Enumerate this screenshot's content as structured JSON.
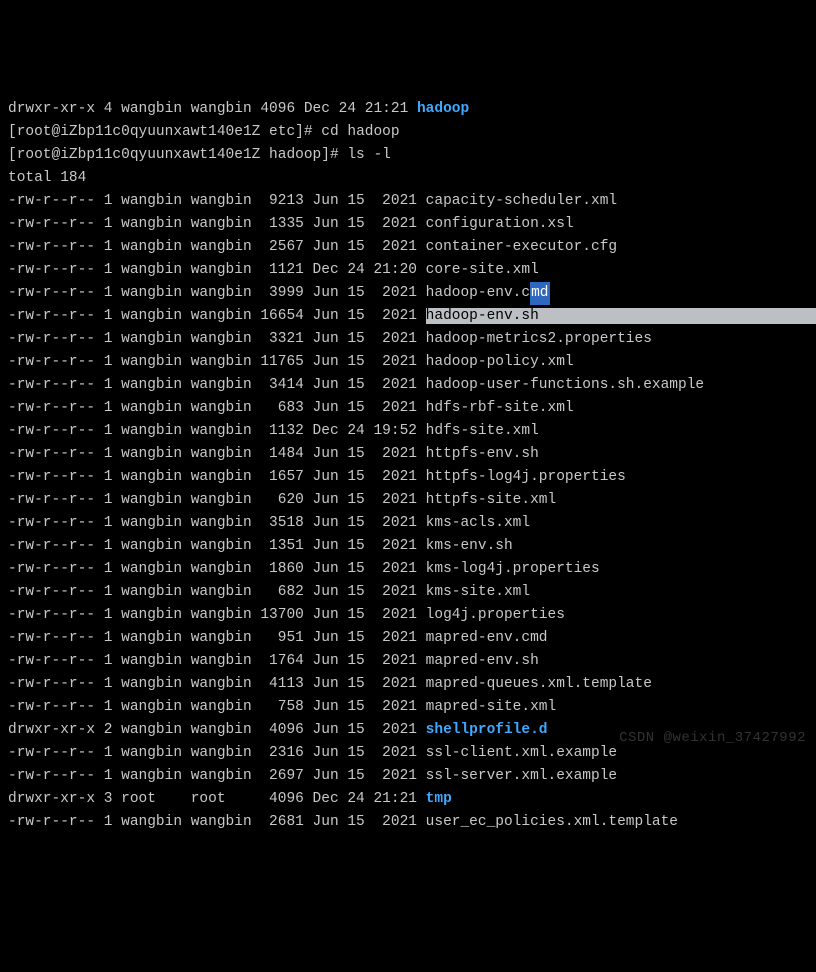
{
  "top_line": {
    "perm": "drwxr-xr-x",
    "links": "4",
    "owner": "wangbin",
    "group": "wangbin",
    "size": "4096",
    "month": "Dec",
    "day": "24",
    "time": "21:21",
    "name": "hadoop"
  },
  "prompts": {
    "line_a_pre": "[root@iZbp11c0qyuunxawt140e1Z etc]# ",
    "line_a_cmd": "cd hadoop",
    "line_b_pre": "[root@iZbp11c0qyuunxawt140e1Z hadoop]# ",
    "line_b_cmd": "ls -l"
  },
  "total_line": "total 184",
  "files": [
    {
      "perm": "-rw-r--r--",
      "links": "1",
      "owner": "wangbin",
      "group": "wangbin",
      "size": "9213",
      "month": "Jun",
      "day": "15",
      "time": "2021",
      "name": "capacity-scheduler.xml",
      "type": "file"
    },
    {
      "perm": "-rw-r--r--",
      "links": "1",
      "owner": "wangbin",
      "group": "wangbin",
      "size": "1335",
      "month": "Jun",
      "day": "15",
      "time": "2021",
      "name": "configuration.xsl",
      "type": "file"
    },
    {
      "perm": "-rw-r--r--",
      "links": "1",
      "owner": "wangbin",
      "group": "wangbin",
      "size": "2567",
      "month": "Jun",
      "day": "15",
      "time": "2021",
      "name": "container-executor.cfg",
      "type": "file"
    },
    {
      "perm": "-rw-r--r--",
      "links": "1",
      "owner": "wangbin",
      "group": "wangbin",
      "size": "1121",
      "month": "Dec",
      "day": "24",
      "time": "21:20",
      "name": "core-site.xml",
      "type": "file"
    },
    {
      "perm": "-rw-r--r--",
      "links": "1",
      "owner": "wangbin",
      "group": "wangbin",
      "size": "3999",
      "month": "Jun",
      "day": "15",
      "time": "2021",
      "name": "hadoop-env.cmd",
      "type": "file",
      "cursor_in_name": true,
      "pre": "hadoop-env.c",
      "cur": "md"
    },
    {
      "perm": "-rw-r--r--",
      "links": "1",
      "owner": "wangbin",
      "group": "wangbin",
      "size": "16654",
      "month": "Jun",
      "day": "15",
      "time": "2021",
      "name": "hadoop-env.sh",
      "type": "file",
      "selected": true
    },
    {
      "perm": "-rw-r--r--",
      "links": "1",
      "owner": "wangbin",
      "group": "wangbin",
      "size": "3321",
      "month": "Jun",
      "day": "15",
      "time": "2021",
      "name": "hadoop-metrics2.properties",
      "type": "file"
    },
    {
      "perm": "-rw-r--r--",
      "links": "1",
      "owner": "wangbin",
      "group": "wangbin",
      "size": "11765",
      "month": "Jun",
      "day": "15",
      "time": "2021",
      "name": "hadoop-policy.xml",
      "type": "file"
    },
    {
      "perm": "-rw-r--r--",
      "links": "1",
      "owner": "wangbin",
      "group": "wangbin",
      "size": "3414",
      "month": "Jun",
      "day": "15",
      "time": "2021",
      "name": "hadoop-user-functions.sh.example",
      "type": "file"
    },
    {
      "perm": "-rw-r--r--",
      "links": "1",
      "owner": "wangbin",
      "group": "wangbin",
      "size": "683",
      "month": "Jun",
      "day": "15",
      "time": "2021",
      "name": "hdfs-rbf-site.xml",
      "type": "file"
    },
    {
      "perm": "-rw-r--r--",
      "links": "1",
      "owner": "wangbin",
      "group": "wangbin",
      "size": "1132",
      "month": "Dec",
      "day": "24",
      "time": "19:52",
      "name": "hdfs-site.xml",
      "type": "file"
    },
    {
      "perm": "-rw-r--r--",
      "links": "1",
      "owner": "wangbin",
      "group": "wangbin",
      "size": "1484",
      "month": "Jun",
      "day": "15",
      "time": "2021",
      "name": "httpfs-env.sh",
      "type": "file"
    },
    {
      "perm": "-rw-r--r--",
      "links": "1",
      "owner": "wangbin",
      "group": "wangbin",
      "size": "1657",
      "month": "Jun",
      "day": "15",
      "time": "2021",
      "name": "httpfs-log4j.properties",
      "type": "file"
    },
    {
      "perm": "-rw-r--r--",
      "links": "1",
      "owner": "wangbin",
      "group": "wangbin",
      "size": "620",
      "month": "Jun",
      "day": "15",
      "time": "2021",
      "name": "httpfs-site.xml",
      "type": "file"
    },
    {
      "perm": "-rw-r--r--",
      "links": "1",
      "owner": "wangbin",
      "group": "wangbin",
      "size": "3518",
      "month": "Jun",
      "day": "15",
      "time": "2021",
      "name": "kms-acls.xml",
      "type": "file"
    },
    {
      "perm": "-rw-r--r--",
      "links": "1",
      "owner": "wangbin",
      "group": "wangbin",
      "size": "1351",
      "month": "Jun",
      "day": "15",
      "time": "2021",
      "name": "kms-env.sh",
      "type": "file"
    },
    {
      "perm": "-rw-r--r--",
      "links": "1",
      "owner": "wangbin",
      "group": "wangbin",
      "size": "1860",
      "month": "Jun",
      "day": "15",
      "time": "2021",
      "name": "kms-log4j.properties",
      "type": "file"
    },
    {
      "perm": "-rw-r--r--",
      "links": "1",
      "owner": "wangbin",
      "group": "wangbin",
      "size": "682",
      "month": "Jun",
      "day": "15",
      "time": "2021",
      "name": "kms-site.xml",
      "type": "file"
    },
    {
      "perm": "-rw-r--r--",
      "links": "1",
      "owner": "wangbin",
      "group": "wangbin",
      "size": "13700",
      "month": "Jun",
      "day": "15",
      "time": "2021",
      "name": "log4j.properties",
      "type": "file"
    },
    {
      "perm": "-rw-r--r--",
      "links": "1",
      "owner": "wangbin",
      "group": "wangbin",
      "size": "951",
      "month": "Jun",
      "day": "15",
      "time": "2021",
      "name": "mapred-env.cmd",
      "type": "file"
    },
    {
      "perm": "-rw-r--r--",
      "links": "1",
      "owner": "wangbin",
      "group": "wangbin",
      "size": "1764",
      "month": "Jun",
      "day": "15",
      "time": "2021",
      "name": "mapred-env.sh",
      "type": "file"
    },
    {
      "perm": "-rw-r--r--",
      "links": "1",
      "owner": "wangbin",
      "group": "wangbin",
      "size": "4113",
      "month": "Jun",
      "day": "15",
      "time": "2021",
      "name": "mapred-queues.xml.template",
      "type": "file"
    },
    {
      "perm": "-rw-r--r--",
      "links": "1",
      "owner": "wangbin",
      "group": "wangbin",
      "size": "758",
      "month": "Jun",
      "day": "15",
      "time": "2021",
      "name": "mapred-site.xml",
      "type": "file"
    },
    {
      "perm": "drwxr-xr-x",
      "links": "2",
      "owner": "wangbin",
      "group": "wangbin",
      "size": "4096",
      "month": "Jun",
      "day": "15",
      "time": "2021",
      "name": "shellprofile.d",
      "type": "dir"
    },
    {
      "perm": "-rw-r--r--",
      "links": "1",
      "owner": "wangbin",
      "group": "wangbin",
      "size": "2316",
      "month": "Jun",
      "day": "15",
      "time": "2021",
      "name": "ssl-client.xml.example",
      "type": "file"
    },
    {
      "perm": "-rw-r--r--",
      "links": "1",
      "owner": "wangbin",
      "group": "wangbin",
      "size": "2697",
      "month": "Jun",
      "day": "15",
      "time": "2021",
      "name": "ssl-server.xml.example",
      "type": "file"
    },
    {
      "perm": "drwxr-xr-x",
      "links": "3",
      "owner": "root",
      "group": "root",
      "size": "4096",
      "month": "Dec",
      "day": "24",
      "time": "21:21",
      "name": "tmp",
      "type": "dir"
    },
    {
      "perm": "-rw-r--r--",
      "links": "1",
      "owner": "wangbin",
      "group": "wangbin",
      "size": "2681",
      "month": "Jun",
      "day": "15",
      "time": "2021",
      "name": "user_ec_policies.xml.template",
      "type": "file"
    }
  ],
  "watermark": "CSDN @weixin_37427992"
}
